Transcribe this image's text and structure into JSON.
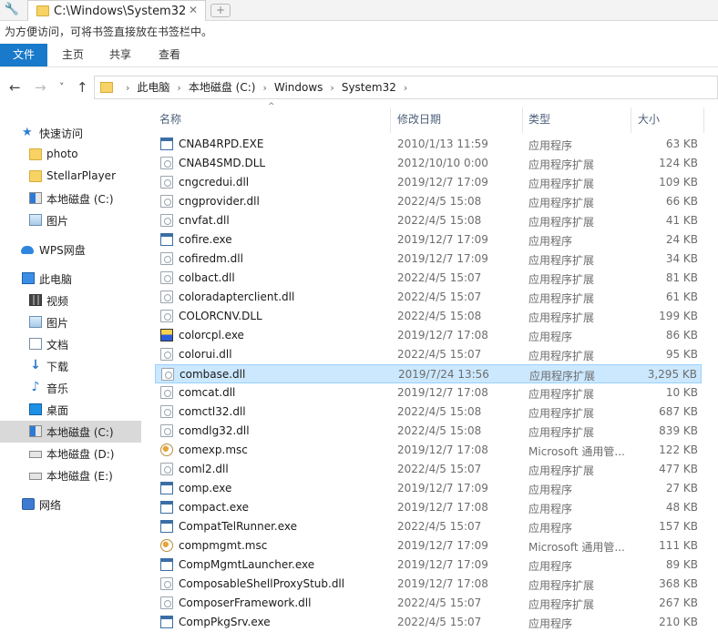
{
  "tabstrip": {
    "tab_title": "C:\\Windows\\System32",
    "close_glyph": "✕",
    "newtab_glyph": "+",
    "wrench_glyph": "🔧"
  },
  "bookmark_hint": "为方便访问，可将书签直接放在书签栏中。",
  "ribbon": {
    "tabs": [
      "文件",
      "主页",
      "共享",
      "查看"
    ]
  },
  "nav_buttons": {
    "back": "←",
    "forward": "→",
    "recent": "˅",
    "up": "↑"
  },
  "breadcrumbs": [
    "此电脑",
    "本地磁盘 (C:)",
    "Windows",
    "System32"
  ],
  "breadcrumb_sep": "›",
  "nav_pane": {
    "items": [
      {
        "label": "快速访问",
        "icon": "star-icon"
      },
      {
        "label": "photo",
        "icon": "folder-icon"
      },
      {
        "label": "StellarPlayer",
        "icon": "folder-icon"
      },
      {
        "label": "本地磁盘 (C:)",
        "icon": "windows-drive-icon"
      },
      {
        "label": "图片",
        "icon": "pictures-icon"
      },
      {
        "label": "WPS网盘",
        "icon": "cloud-icon"
      },
      {
        "label": "此电脑",
        "icon": "pc-icon"
      },
      {
        "label": "视频",
        "icon": "video-icon"
      },
      {
        "label": "图片",
        "icon": "pictures-icon"
      },
      {
        "label": "文档",
        "icon": "document-icon"
      },
      {
        "label": "下载",
        "icon": "download-icon"
      },
      {
        "label": "音乐",
        "icon": "music-icon"
      },
      {
        "label": "桌面",
        "icon": "desktop-icon"
      },
      {
        "label": "本地磁盘 (C:)",
        "icon": "windows-drive-icon"
      },
      {
        "label": "本地磁盘 (D:)",
        "icon": "drive-icon"
      },
      {
        "label": "本地磁盘 (E:)",
        "icon": "drive-icon"
      },
      {
        "label": "网络",
        "icon": "network-icon"
      }
    ]
  },
  "columns": {
    "name": "名称",
    "date": "修改日期",
    "type": "类型",
    "size": "大小"
  },
  "files": [
    {
      "name": "CNAB4RPD.EXE",
      "date": "2010/1/13 11:59",
      "type": "应用程序",
      "size": "63 KB",
      "icon": "exe"
    },
    {
      "name": "CNAB4SMD.DLL",
      "date": "2012/10/10 0:00",
      "type": "应用程序扩展",
      "size": "124 KB",
      "icon": "dll"
    },
    {
      "name": "cngcredui.dll",
      "date": "2019/12/7 17:09",
      "type": "应用程序扩展",
      "size": "109 KB",
      "icon": "dll"
    },
    {
      "name": "cngprovider.dll",
      "date": "2022/4/5 15:08",
      "type": "应用程序扩展",
      "size": "66 KB",
      "icon": "dll"
    },
    {
      "name": "cnvfat.dll",
      "date": "2022/4/5 15:08",
      "type": "应用程序扩展",
      "size": "41 KB",
      "icon": "dll"
    },
    {
      "name": "cofire.exe",
      "date": "2019/12/7 17:09",
      "type": "应用程序",
      "size": "24 KB",
      "icon": "exe"
    },
    {
      "name": "cofiredm.dll",
      "date": "2019/12/7 17:09",
      "type": "应用程序扩展",
      "size": "34 KB",
      "icon": "dll"
    },
    {
      "name": "colbact.dll",
      "date": "2022/4/5 15:07",
      "type": "应用程序扩展",
      "size": "81 KB",
      "icon": "dll"
    },
    {
      "name": "coloradapterclient.dll",
      "date": "2022/4/5 15:07",
      "type": "应用程序扩展",
      "size": "61 KB",
      "icon": "dll"
    },
    {
      "name": "COLORCNV.DLL",
      "date": "2022/4/5 15:08",
      "type": "应用程序扩展",
      "size": "199 KB",
      "icon": "dll"
    },
    {
      "name": "colorcpl.exe",
      "date": "2019/12/7 17:08",
      "type": "应用程序",
      "size": "86 KB",
      "icon": "cpl"
    },
    {
      "name": "colorui.dll",
      "date": "2022/4/5 15:07",
      "type": "应用程序扩展",
      "size": "95 KB",
      "icon": "dll"
    },
    {
      "name": "combase.dll",
      "date": "2019/7/24 13:56",
      "type": "应用程序扩展",
      "size": "3,295 KB",
      "icon": "dll",
      "selected": true
    },
    {
      "name": "comcat.dll",
      "date": "2019/12/7 17:08",
      "type": "应用程序扩展",
      "size": "10 KB",
      "icon": "dll"
    },
    {
      "name": "comctl32.dll",
      "date": "2022/4/5 15:08",
      "type": "应用程序扩展",
      "size": "687 KB",
      "icon": "dll"
    },
    {
      "name": "comdlg32.dll",
      "date": "2022/4/5 15:08",
      "type": "应用程序扩展",
      "size": "839 KB",
      "icon": "dll"
    },
    {
      "name": "comexp.msc",
      "date": "2019/12/7 17:08",
      "type": "Microsoft 通用管...",
      "size": "122 KB",
      "icon": "msc"
    },
    {
      "name": "coml2.dll",
      "date": "2022/4/5 15:07",
      "type": "应用程序扩展",
      "size": "477 KB",
      "icon": "dll"
    },
    {
      "name": "comp.exe",
      "date": "2019/12/7 17:09",
      "type": "应用程序",
      "size": "27 KB",
      "icon": "exe"
    },
    {
      "name": "compact.exe",
      "date": "2019/12/7 17:08",
      "type": "应用程序",
      "size": "48 KB",
      "icon": "exe"
    },
    {
      "name": "CompatTelRunner.exe",
      "date": "2022/4/5 15:07",
      "type": "应用程序",
      "size": "157 KB",
      "icon": "exe"
    },
    {
      "name": "compmgmt.msc",
      "date": "2019/12/7 17:09",
      "type": "Microsoft 通用管...",
      "size": "111 KB",
      "icon": "msc"
    },
    {
      "name": "CompMgmtLauncher.exe",
      "date": "2019/12/7 17:09",
      "type": "应用程序",
      "size": "89 KB",
      "icon": "exe"
    },
    {
      "name": "ComposableShellProxyStub.dll",
      "date": "2019/12/7 17:08",
      "type": "应用程序扩展",
      "size": "368 KB",
      "icon": "dll"
    },
    {
      "name": "ComposerFramework.dll",
      "date": "2022/4/5 15:07",
      "type": "应用程序扩展",
      "size": "267 KB",
      "icon": "dll"
    },
    {
      "name": "CompPkgSrv.exe",
      "date": "2022/4/5 15:07",
      "type": "应用程序",
      "size": "210 KB",
      "icon": "exe"
    }
  ],
  "colors": {
    "file_tab": "#1979ca",
    "selection": "#cce8ff",
    "selection_border": "#99d1ff",
    "nav_selected": "#d9d9d9"
  }
}
